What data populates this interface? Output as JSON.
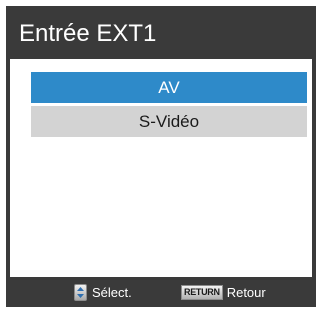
{
  "menu": {
    "title": "Entrée EXT1"
  },
  "options": [
    {
      "label": "AV",
      "selected": true
    },
    {
      "label": "S-Vidéo",
      "selected": false
    }
  ],
  "footer": {
    "select_icon": "up-down-arrows-icon",
    "select_label": "Sélect.",
    "return_key_label": "RETURN",
    "return_label": "Retour"
  },
  "colors": {
    "background": "#3a3a3a",
    "selected": "#2e8ac9",
    "unselected": "#d3d3d3"
  }
}
